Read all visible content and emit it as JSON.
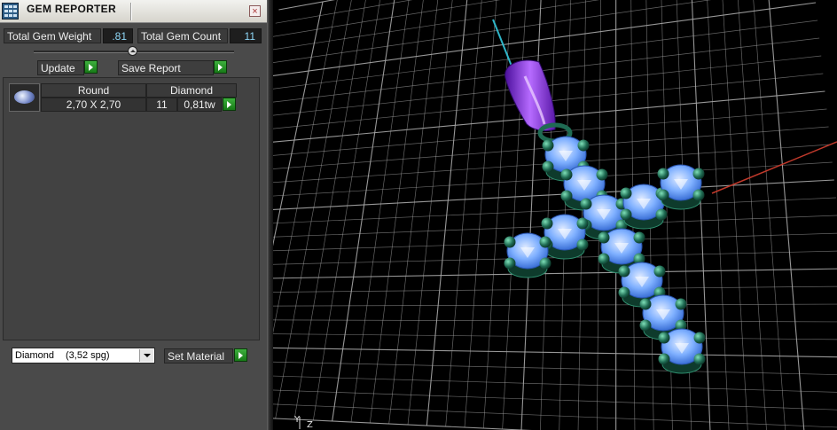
{
  "window": {
    "title": "GEM REPORTER",
    "close_glyph": "×"
  },
  "summary": {
    "weight_label": "Total Gem Weight",
    "weight_value": ".81",
    "count_label": "Total Gem Count",
    "count_value": "11"
  },
  "actions": {
    "update_label": "Update",
    "save_label": "Save Report"
  },
  "gem_table": {
    "headers": [
      "Round",
      "Diamond"
    ],
    "rows": [
      {
        "size": "2,70 X 2,70",
        "count": "11",
        "weight": "0,81tw"
      }
    ]
  },
  "material": {
    "selected_name": "Diamond",
    "selected_sg": "(3,52 spg)",
    "set_label": "Set Material"
  },
  "viewport": {
    "axis_labels": {
      "y": "Y",
      "z": "Z"
    },
    "colors": {
      "grid": "#a8a8a8",
      "gem": "#7fb0ff",
      "prong": "#1f6b53",
      "bail": "#8a2be2",
      "axis_red": "#c0392b",
      "axis_cyan": "#2fb6c8"
    }
  },
  "icons": [
    "app-icon",
    "close-icon",
    "slider-knob-icon",
    "gem-thumbnail-icon",
    "arrow-right-icon",
    "chevron-down-icon"
  ]
}
